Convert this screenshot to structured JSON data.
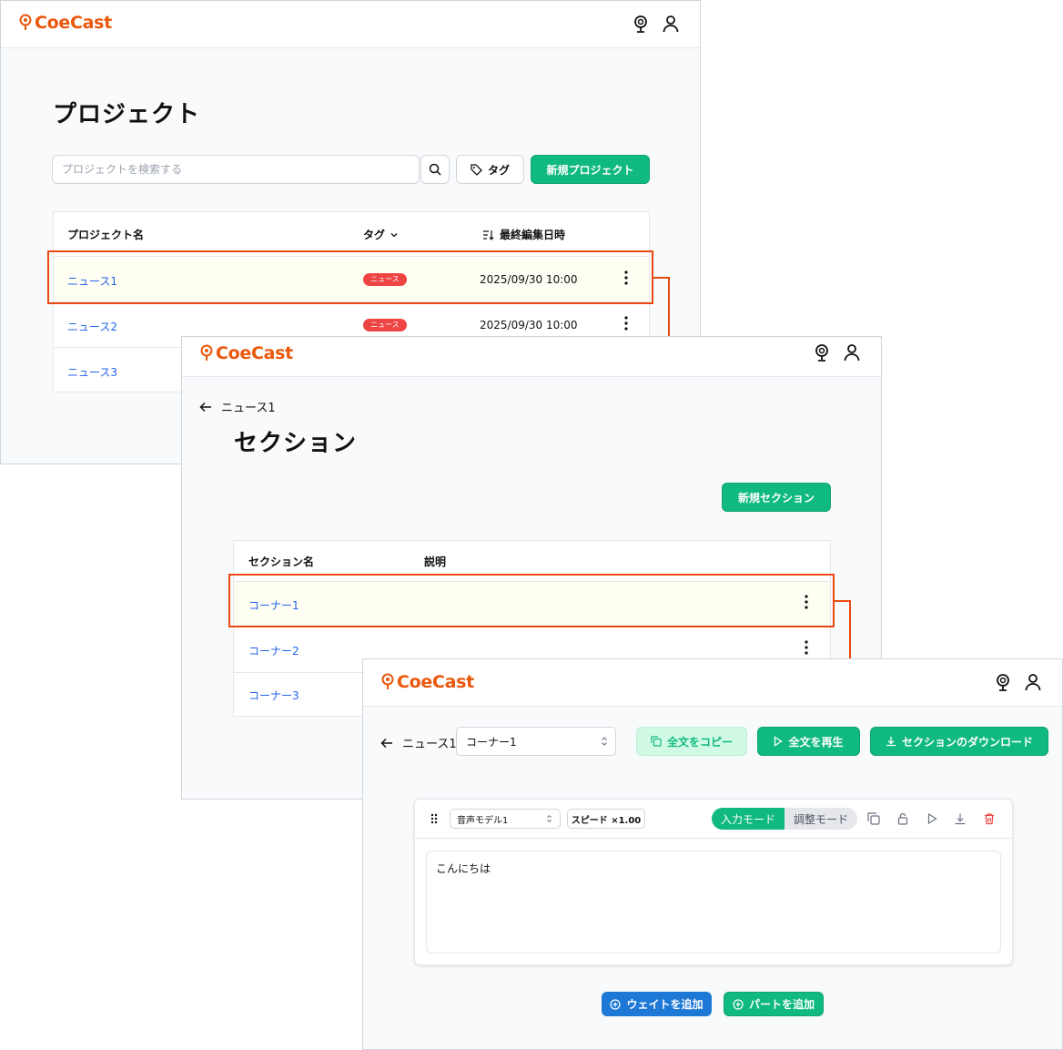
{
  "app": {
    "logo_text": "CoeCast",
    "accent": "#ea580c",
    "primary_green": "#10b981",
    "link_blue": "#2563eb",
    "badge_red": "#ef4444",
    "highlight_color": "#ea4a12"
  },
  "projects_screen": {
    "title": "プロジェクト",
    "search_placeholder": "プロジェクトを検索する",
    "tag_button": "タグ",
    "new_button": "新規プロジェクト",
    "columns": {
      "name": "プロジェクト名",
      "tag": "タグ",
      "updated": "最終編集日時"
    },
    "rows": [
      {
        "name": "ニュース1",
        "tag": "ニュース",
        "updated": "2025/09/30 10:00"
      },
      {
        "name": "ニュース2",
        "tag": "ニュース",
        "updated": "2025/09/30 10:00"
      },
      {
        "name": "ニュース3"
      }
    ]
  },
  "sections_screen": {
    "breadcrumb": "ニュース1",
    "title": "セクション",
    "new_button": "新規セクション",
    "columns": {
      "name": "セクション名",
      "description": "説明"
    },
    "rows": [
      {
        "name": "コーナー1"
      },
      {
        "name": "コーナー2"
      },
      {
        "name": "コーナー3"
      }
    ]
  },
  "editor_screen": {
    "breadcrumb": "ニュース1",
    "section_select": "コーナー1",
    "copy_button": "全文をコピー",
    "play_button": "全文を再生",
    "download_button": "セクションのダウンロード",
    "voice_model": "音声モデル1",
    "speed": "スピード ×1.00",
    "mode_input": "入力モード",
    "mode_adjust": "調整モード",
    "text": "こんにちは",
    "add_wait_button": "ウェイトを追加",
    "add_part_button": "パートを追加"
  }
}
